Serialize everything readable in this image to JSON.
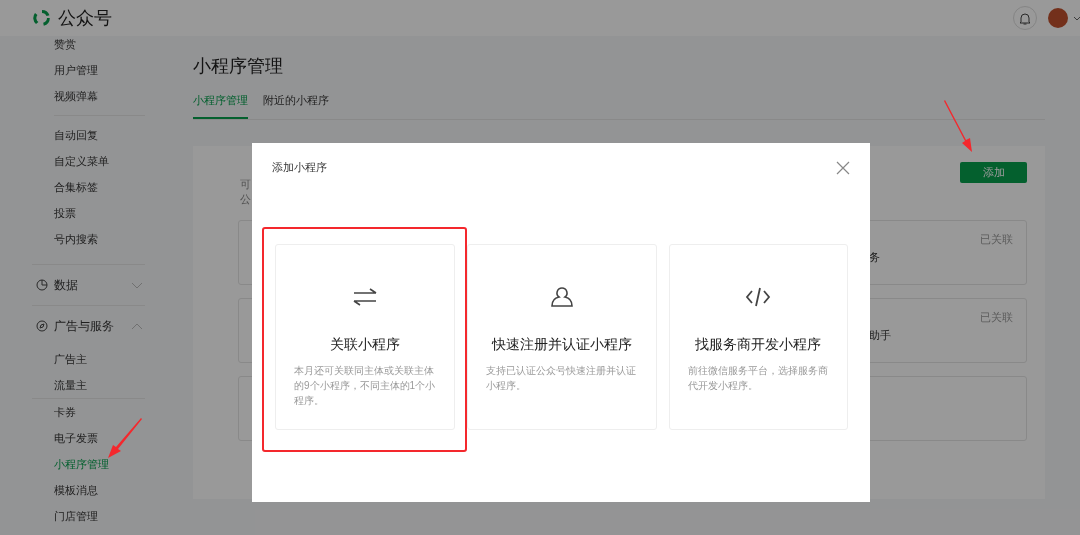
{
  "topbar": {
    "title": "公众号"
  },
  "sidebar": {
    "groups": [
      {
        "items": [
          {
            "label": "赞赏",
            "selected": false
          },
          {
            "label": "用户管理",
            "selected": false
          },
          {
            "label": "视频弹幕",
            "selected": false
          }
        ]
      },
      {
        "items": [
          {
            "label": "自动回复",
            "selected": false
          },
          {
            "label": "自定义菜单",
            "selected": false
          },
          {
            "label": "合集标签",
            "selected": false
          },
          {
            "label": "投票",
            "selected": false
          },
          {
            "label": "号内搜索",
            "selected": false
          }
        ]
      },
      {
        "heading": "数据",
        "expanded": false
      },
      {
        "heading": "广告与服务",
        "expanded": true,
        "items": [
          {
            "label": "广告主",
            "selected": false
          },
          {
            "label": "流量主",
            "selected": false
          }
        ]
      },
      {
        "items": [
          {
            "label": "卡券",
            "selected": false
          },
          {
            "label": "电子发票",
            "selected": false
          },
          {
            "label": "小程序管理",
            "selected": true
          },
          {
            "label": "模板消息",
            "selected": false
          },
          {
            "label": "门店管理",
            "selected": false
          }
        ]
      }
    ]
  },
  "page": {
    "title": "小程序管理",
    "tabs": [
      {
        "label": "小程序管理",
        "selected": true
      },
      {
        "label": "附近的小程序",
        "selected": false
      }
    ],
    "intro_lines": [
      "可",
      "公"
    ],
    "add_button": "添加",
    "linked": [
      {
        "name": "务",
        "status": "已关联"
      },
      {
        "name": "助手",
        "status": "已关联"
      }
    ]
  },
  "modal": {
    "title": "添加小程序",
    "options": [
      {
        "kind": "link",
        "title": "关联小程序",
        "description": "本月还可关联同主体或关联主体的9个小程序，不同主体的1个小程序。",
        "highlighted": true
      },
      {
        "kind": "register",
        "title": "快速注册并认证小程序",
        "description": "支持已认证公众号快速注册并认证小程序。",
        "highlighted": false
      },
      {
        "kind": "developer",
        "title": "找服务商开发小程序",
        "description": "前往微信服务平台，选择服务商代开发小程序。",
        "highlighted": false
      }
    ]
  }
}
